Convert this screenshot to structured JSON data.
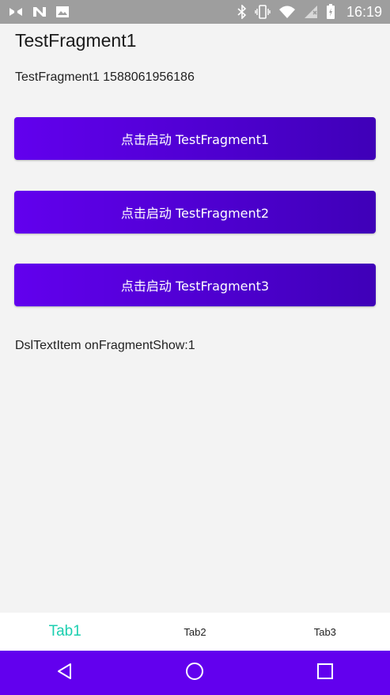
{
  "status_bar": {
    "time": "16:19",
    "left_icons": [
      "debug-icon",
      "n-icon",
      "image-icon"
    ],
    "right_icons": [
      "bluetooth-icon",
      "vibrate-icon",
      "wifi-icon",
      "no-sim-icon",
      "battery-icon"
    ]
  },
  "page": {
    "title": "TestFragment1",
    "info": "TestFragment1 1588061956186",
    "buttons": [
      {
        "label": "点击启动 TestFragment1"
      },
      {
        "label": "点击启动 TestFragment2"
      },
      {
        "label": "点击启动 TestFragment3"
      }
    ],
    "show_text": "DslTextItem onFragmentShow:1"
  },
  "tabs": [
    {
      "label": "Tab1",
      "active": true
    },
    {
      "label": "Tab2",
      "active": false
    },
    {
      "label": "Tab3",
      "active": false
    }
  ],
  "nav_bar": {
    "buttons": [
      "back-icon",
      "home-icon",
      "recents-icon"
    ]
  },
  "colors": {
    "accent_gradient_start": "#6200ee",
    "accent_gradient_end": "#3f00b8",
    "active_tab": "#1ccfb0",
    "nav_bar": "#6200ee",
    "status_bar": "#9e9e9e"
  }
}
